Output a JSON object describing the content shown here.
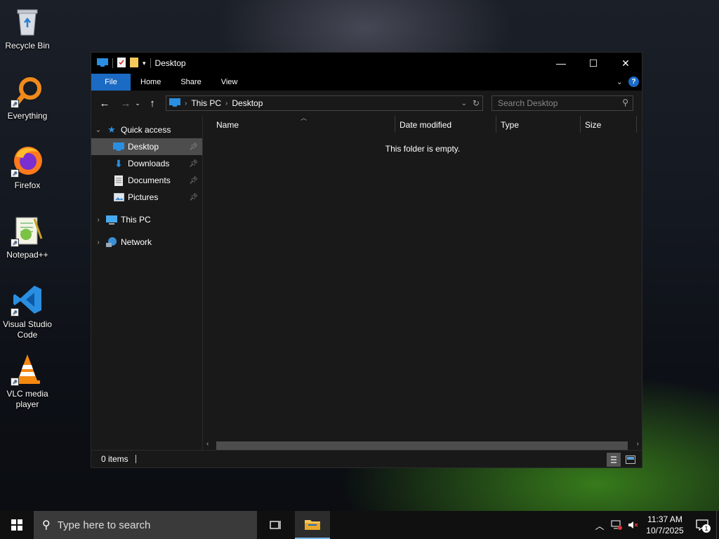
{
  "desktop": {
    "icons": [
      {
        "label": "Recycle Bin"
      },
      {
        "label": "Everything"
      },
      {
        "label": "Firefox"
      },
      {
        "label": "Notepad++"
      },
      {
        "label": "Visual Studio Code"
      },
      {
        "label": "VLC media player"
      }
    ]
  },
  "window": {
    "title": "Desktop",
    "ribbon_tabs": [
      "File",
      "Home",
      "Share",
      "View"
    ],
    "help": "?",
    "address": {
      "crumbs": [
        "This PC",
        "Desktop"
      ]
    },
    "search": {
      "placeholder": "Search Desktop"
    },
    "nav_pane": {
      "quick_access": "Quick access",
      "pinned": [
        "Desktop",
        "Downloads",
        "Documents",
        "Pictures"
      ],
      "this_pc": "This PC",
      "network": "Network"
    },
    "columns": [
      "Name",
      "Date modified",
      "Type",
      "Size"
    ],
    "empty_message": "This folder is empty.",
    "status": {
      "item_count": "0 items"
    }
  },
  "taskbar": {
    "search_placeholder": "Type here to search",
    "clock": {
      "time": "11:37 AM",
      "date": "10/7/2025"
    },
    "notification_count": "1"
  },
  "colors": {
    "accent": "#1b6bc4",
    "window_bg": "#191919",
    "selected_bg": "#4d4d4d"
  }
}
